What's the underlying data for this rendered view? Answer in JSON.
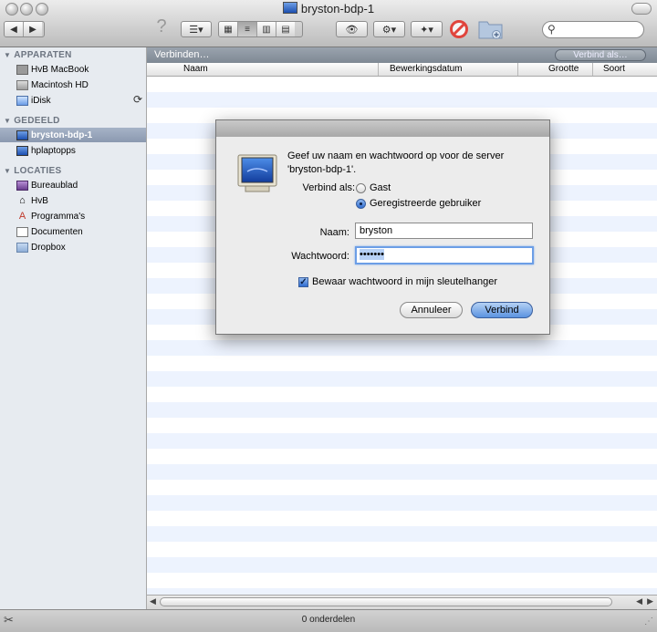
{
  "window": {
    "title": "bryston-bdp-1"
  },
  "toolbar": {
    "help_glyph": "?",
    "arrange_glyph": "☰▾",
    "eye_glyph": "👁",
    "gear_glyph": "⚙▾",
    "dropbox_glyph": "✦▾",
    "back_glyph": "◀",
    "forward_glyph": "▶",
    "search_placeholder": ""
  },
  "sidebar": {
    "sections": [
      {
        "label": "APPARATEN",
        "items": [
          "HvB MacBook",
          "Macintosh HD",
          "iDisk"
        ]
      },
      {
        "label": "GEDEELD",
        "items": [
          "bryston-bdp-1",
          "hplaptopps"
        ]
      },
      {
        "label": "LOCATIES",
        "items": [
          "Bureaublad",
          "HvB",
          "Programma's",
          "Documenten",
          "Dropbox"
        ]
      }
    ],
    "selected": "bryston-bdp-1"
  },
  "main": {
    "path_label": "Verbinden…",
    "connect_as_button": "Verbind als…",
    "columns": [
      "Naam",
      "Bewerkingsdatum",
      "Grootte",
      "Soort"
    ]
  },
  "dialog": {
    "message_line1": "Geef uw naam en wachtwoord op voor de server",
    "message_line2": "'bryston-bdp-1'.",
    "connect_as_label": "Verbind als:",
    "radio_guest": "Gast",
    "radio_registered": "Geregistreerde gebruiker",
    "selected_radio": "registered",
    "name_label": "Naam:",
    "name_value": "bryston",
    "password_label": "Wachtwoord:",
    "password_value": "•••••••",
    "keychain_label": "Bewaar wachtwoord in mijn sleutelhanger",
    "keychain_checked": true,
    "cancel_button": "Annuleer",
    "connect_button": "Verbind"
  },
  "statusbar": {
    "text": "0 onderdelen"
  }
}
